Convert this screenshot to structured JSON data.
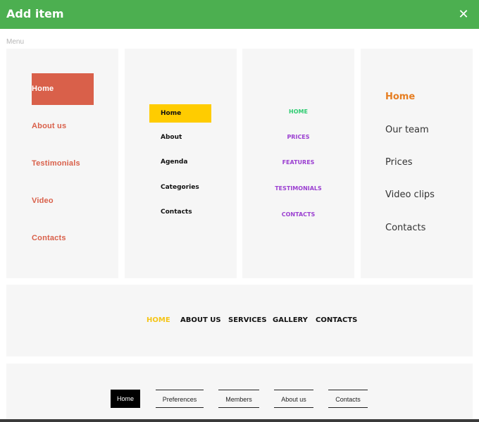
{
  "dialog": {
    "title": "Add item",
    "close_icon": "close-icon",
    "close_glyph": "✕",
    "section_label": "Menu"
  },
  "colors": {
    "header_bg": "#4caf50",
    "card_bg": "#f6f6f6",
    "menu1_accent": "#d9604a",
    "menu2_accent": "#ffcc00",
    "menu3_active": "#2ecc71",
    "menu3_text": "#9b3fd1",
    "menu4_active": "#e67e22",
    "menu5_active": "#f5c518"
  },
  "menus": [
    {
      "items": [
        "Home",
        "About us",
        "Testimonials",
        "Video",
        "Contacts"
      ],
      "active": "Home"
    },
    {
      "items": [
        "Home",
        "About",
        "Agenda",
        "Categories",
        "Contacts"
      ],
      "active": "Home"
    },
    {
      "items": [
        "HOME",
        "PRICES",
        "FEATURES",
        "TESTIMONIALS",
        "CONTACTS"
      ],
      "active": "HOME"
    },
    {
      "items": [
        "Home",
        "Our team",
        "Prices",
        "Video clips",
        "Contacts"
      ],
      "active": "Home"
    },
    {
      "items": [
        "HOME",
        "ABOUT US",
        "SERVICES",
        "GALLERY",
        "CONTACTS"
      ],
      "active": "HOME"
    },
    {
      "items": [
        "Home",
        "Preferences",
        "Members",
        "About us",
        "Contacts"
      ],
      "active": "Home"
    }
  ]
}
